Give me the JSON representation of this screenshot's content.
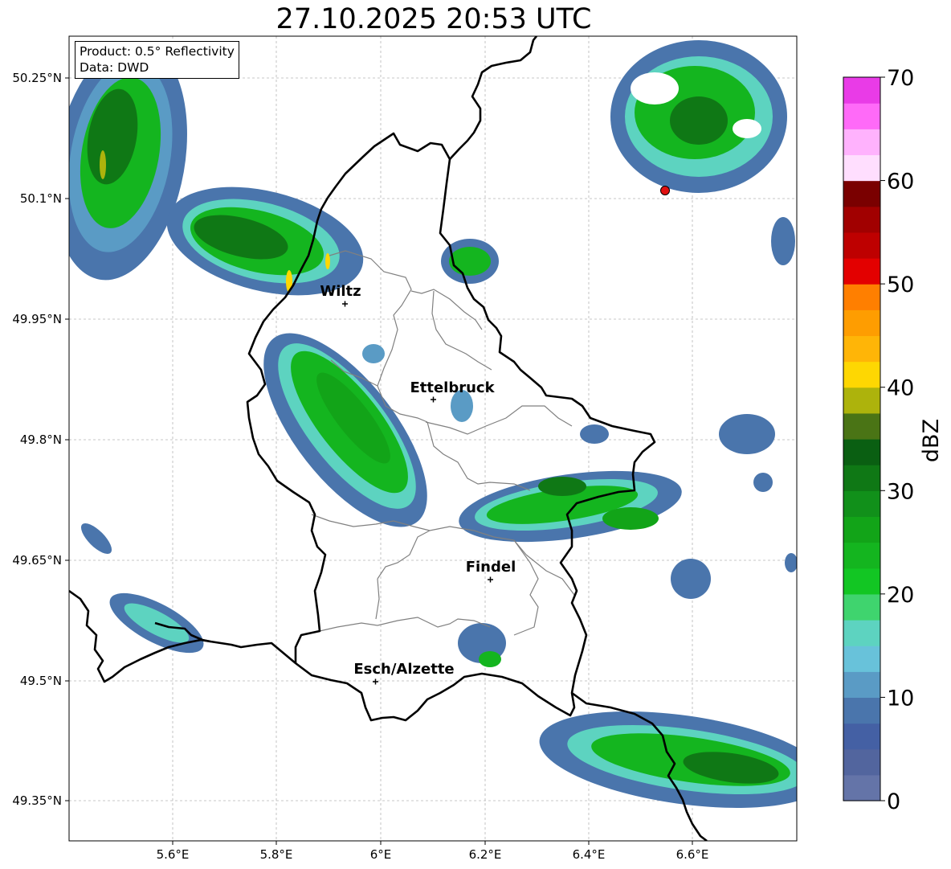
{
  "title": "27.10.2025 20:53 UTC",
  "info": {
    "product_line": "Product: 0.5° Reflectivity",
    "data_line": "Data: DWD"
  },
  "axes": {
    "lon_ticks": [
      "5.6°E",
      "5.8°E",
      "6°E",
      "6.2°E",
      "6.4°E",
      "6.6°E"
    ],
    "lat_ticks": [
      "50.25°N",
      "50.1°N",
      "49.95°N",
      "49.8°N",
      "49.65°N",
      "49.5°N",
      "49.35°N"
    ]
  },
  "cities": [
    {
      "name": "Wiltz"
    },
    {
      "name": "Ettelbruck"
    },
    {
      "name": "Findel"
    },
    {
      "name": "Esch/Alzette"
    }
  ],
  "colorbar": {
    "label": "dBZ",
    "ticks": [
      "0",
      "10",
      "20",
      "30",
      "40",
      "50",
      "60",
      "70"
    ],
    "min": 0,
    "max": 70,
    "step": 2.5,
    "colors": [
      "#6474a8",
      "#52659e",
      "#4460a4",
      "#4a75ac",
      "#5a9bc5",
      "#68c2da",
      "#5dd3c0",
      "#3fd46e",
      "#12c623",
      "#14b51f",
      "#12a418",
      "#11901a",
      "#0f7815",
      "#0a5f12",
      "#4a7415",
      "#adb30c",
      "#fed702",
      "#ffb507",
      "#fe9d01",
      "#ff7f00",
      "#e30000",
      "#be0000",
      "#a10000",
      "#7a0000",
      "#ffdefe",
      "#ffb2fd",
      "#ff6af8",
      "#e93be7"
    ]
  },
  "colors": {
    "border_national": "#000000",
    "border_district": "#808080",
    "radar_site": "#e01010"
  }
}
